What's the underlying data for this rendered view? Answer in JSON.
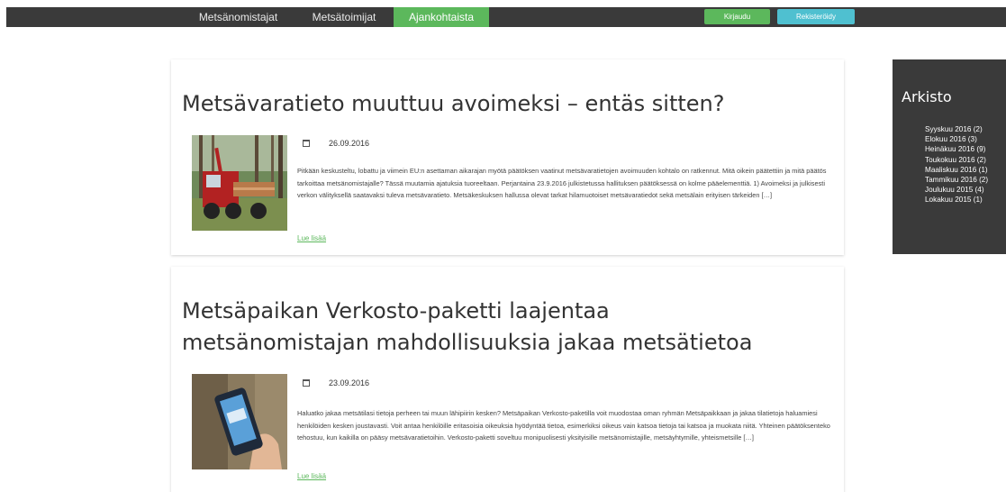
{
  "nav": {
    "items": [
      {
        "label": "Metsänomistajat"
      },
      {
        "label": "Metsätoimijat"
      },
      {
        "label": "Ajankohtaista"
      }
    ],
    "login_label": "Kirjaudu",
    "register_label": "Rekisteröidy"
  },
  "posts": [
    {
      "title": "Metsävaratieto muuttuu avoimeksi – entäs sitten?",
      "date": "26.09.2016",
      "excerpt": "Pitkään keskusteltu, lobattu ja viimein EU:n asettaman aikarajan myötä päätöksen vaatinut metsävaratietojen avoimuuden kohtalo on ratkennut. Mitä oikein päätettiin ja mitä päätös tarkoittaa metsänomistajalle? Tässä muutamia ajatuksia tuoreeltaan. Perjantaina 23.9.2016 julkistetussa hallituksen päätöksessä on kolme pääelementtiä. 1) Avoimeksi ja julkisesti verkon välityksellä saatavaksi tuleva metsävaratieto. Metsäkeskuksen hallussa olevat tarkat hilamuotoiset metsävaratiedot sekä metsälain erityisen tärkeiden […]",
      "read_more": "Lue lisää"
    },
    {
      "title": "Metsäpaikan Verkosto-paketti laajentaa metsänomistajan mahdollisuuksia jakaa metsätietoa",
      "date": "23.09.2016",
      "excerpt": "Haluatko jakaa metsätilasi tietoja perheen tai muun lähipiirin kesken? Metsäpaikan Verkosto-paketilla voit muodostaa oman ryhmän Metsäpaikkaan ja jakaa tilatietoja haluamiesi henkilöiden kesken joustavasti. Voit antaa henkilöille eritasoisia oikeuksia hyödyntää tietoa, esimerkiksi oikeus vain katsoa tietoja tai katsoa ja muokata niitä. Yhteinen päätöksenteko tehostuu, kun kaikilla on pääsy metsävaratietoihin. Verkosto-paketti soveltuu monipuolisesti yksityisille metsänomistajille, metsäyhtymille, yhteismetsille […]",
      "read_more": "Lue lisää"
    }
  ],
  "archive": {
    "title": "Arkisto",
    "items": [
      {
        "label": "Syyskuu 2016 (2)"
      },
      {
        "label": "Elokuu 2016 (3)"
      },
      {
        "label": "Heinäkuu 2016 (9)"
      },
      {
        "label": "Toukokuu 2016 (2)"
      },
      {
        "label": "Maaliskuu 2016 (1)"
      },
      {
        "label": "Tammikuu 2016 (2)"
      },
      {
        "label": "Joulukuu 2015 (4)"
      },
      {
        "label": "Lokakuu 2015 (1)"
      }
    ]
  },
  "colors": {
    "nav_bg": "#3a3a3a",
    "accent_green": "#5cb85c",
    "accent_cyan": "#4fc0d0"
  }
}
